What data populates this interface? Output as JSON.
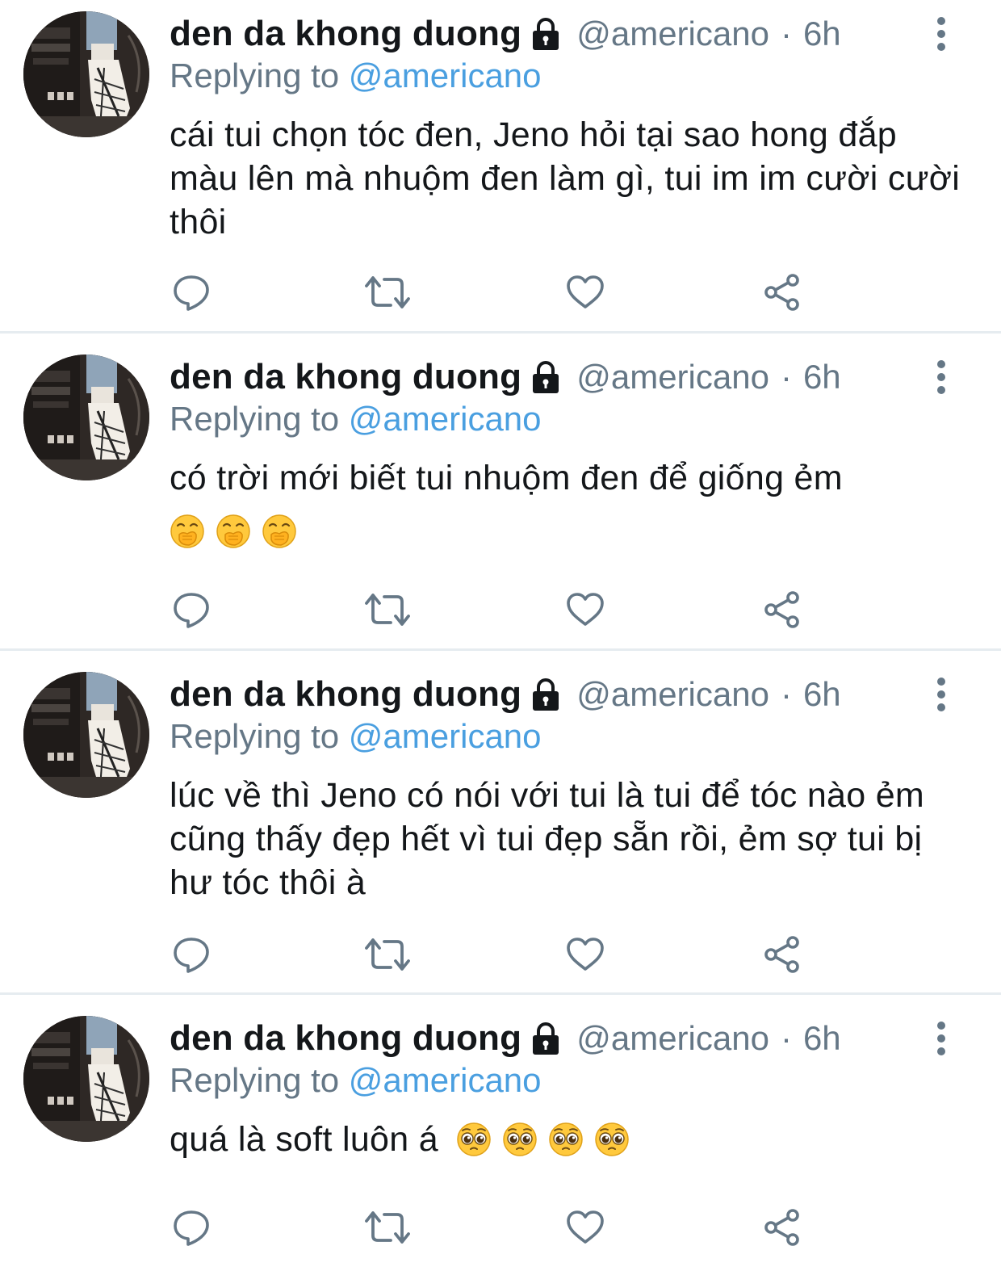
{
  "tweets": [
    {
      "name": "den da khong duong",
      "handle": "@americano",
      "separator": "·",
      "time": "6h",
      "replying_label": "Replying to",
      "replying_to": "@americano",
      "text": "cái tui chọn tóc đen, Jeno hỏi tại sao hong đắp màu lên mà nhuộm đen làm gì, tui im im cười cười thôi",
      "emojis": []
    },
    {
      "name": "den da khong duong",
      "handle": "@americano",
      "separator": "·",
      "time": "6h",
      "replying_label": "Replying to",
      "replying_to": "@americano",
      "text": "có trời mới biết tui nhuộm đen để giống ẻm",
      "emojis": [
        "face-with-hand-over-mouth",
        "face-with-hand-over-mouth",
        "face-with-hand-over-mouth"
      ]
    },
    {
      "name": "den da khong duong",
      "handle": "@americano",
      "separator": "·",
      "time": "6h",
      "replying_label": "Replying to",
      "replying_to": "@americano",
      "text": "lúc về thì Jeno có nói với tui là tui để tóc nào ẻm cũng thấy đẹp hết vì tui đẹp sẵn rồi, ẻm sợ tui bị hư tóc thôi à",
      "emojis": []
    },
    {
      "name": "den da khong duong",
      "handle": "@americano",
      "separator": "·",
      "time": "6h",
      "replying_label": "Replying to",
      "replying_to": "@americano",
      "text": "quá là soft luôn á",
      "emojis": [
        "pleading-face",
        "pleading-face",
        "pleading-face",
        "pleading-face"
      ]
    }
  ],
  "icons": {
    "protected": "lock-icon",
    "more": "more-vertical-icon",
    "reply": "reply-icon",
    "retweet": "retweet-icon",
    "like": "heart-icon",
    "share": "share-icon"
  },
  "colors": {
    "name": "#14171a",
    "secondary": "#657786",
    "mention": "#4a9fe0",
    "icon": "#657786",
    "divider": "#e6ecf0"
  }
}
